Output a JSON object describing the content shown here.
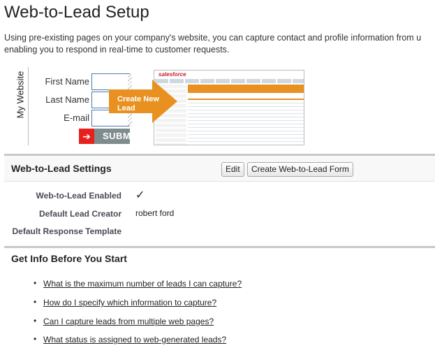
{
  "page": {
    "title": "Web-to-Lead Setup",
    "intro_line1": "Using pre-existing pages on your company's website, you can capture contact and profile information from u",
    "intro_line2": "enabling you to respond in real-time to customer requests."
  },
  "illustration": {
    "site_label": "My Website",
    "fields": [
      "First Name",
      "Last Name",
      "E-mail"
    ],
    "submit_label": "SUBM",
    "callout": "Create New Lead",
    "sf_logo": "salesforce"
  },
  "settings": {
    "title": "Web-to-Lead Settings",
    "edit_label": "Edit",
    "create_label": "Create Web-to-Lead Form",
    "rows": [
      {
        "label": "Web-to-Lead Enabled",
        "value": "✓"
      },
      {
        "label": "Default Lead Creator",
        "value": "robert ford"
      },
      {
        "label": "Default Response Template",
        "value": ""
      }
    ]
  },
  "info": {
    "title": "Get Info Before You Start",
    "questions": [
      "What is the maximum number of leads I can capture?",
      "How do I specify which information to capture?",
      "Can I capture leads from multiple web pages?",
      "What status is assigned to web-generated leads?"
    ]
  },
  "colors": {
    "accent_orange": "#e89121",
    "submit_red": "#e8201d",
    "link": "#222222"
  }
}
